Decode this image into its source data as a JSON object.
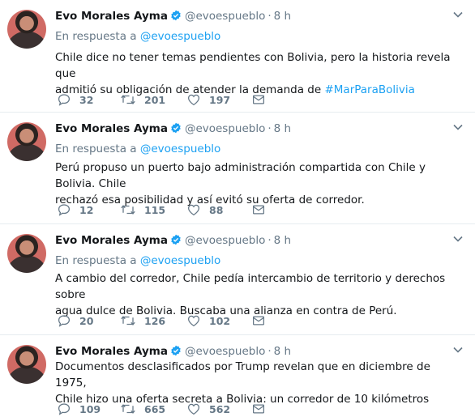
{
  "tweets": [
    {
      "name": "Evo Morales Ayma",
      "handle": "@evoespueblo",
      "dot": "·",
      "time": "8 h",
      "reply_prefix": "En respuesta a",
      "reply_handle": "@evoespueblo",
      "text_line1": "Chile dice no tener temas pendientes con Bolivia, pero la historia revela que",
      "text_line2": "admitió su obligación de atender la demanda de",
      "hashtag": "#MarParaBolivia",
      "replies": "32",
      "retweets": "201",
      "likes": "197"
    },
    {
      "name": "Evo Morales Ayma",
      "handle": "@evoespueblo",
      "dot": "·",
      "time": "8 h",
      "reply_prefix": "En respuesta a",
      "reply_handle": "@evoespueblo",
      "text_line1": "Perú propuso un puerto bajo administración compartida con Chile y Bolivia. Chile",
      "text_line2": "rechazó esa posibilidad y así evitó su oferta de corredor.",
      "replies": "12",
      "retweets": "115",
      "likes": "88"
    },
    {
      "name": "Evo Morales Ayma",
      "handle": "@evoespueblo",
      "dot": "·",
      "time": "8 h",
      "reply_prefix": "En respuesta a",
      "reply_handle": "@evoespueblo",
      "text_line1": "A cambio del corredor, Chile pedía intercambio de territorio y derechos sobre",
      "text_line2": "agua dulce de Bolivia. Buscaba una alianza en contra de Perú.",
      "replies": "20",
      "retweets": "126",
      "likes": "102"
    },
    {
      "name": "Evo Morales Ayma",
      "handle": "@evoespueblo",
      "dot": "·",
      "time": "8 h",
      "text_line1": "Documentos desclasificados por Trump revelan que en diciembre de 1975,",
      "text_line2": "Chile hizo una oferta secreta a Bolivia: un corredor de 10 kilómetros",
      "replies": "109",
      "retweets": "665",
      "likes": "562"
    }
  ],
  "icons": {
    "verified": "verified-badge-icon",
    "menu": "chevron-down-icon",
    "reply": "reply-icon",
    "retweet": "retweet-icon",
    "like": "heart-icon",
    "dm": "envelope-icon"
  },
  "colors": {
    "link": "#1da1f2",
    "secondary": "#657786",
    "divider": "#e6ecf0"
  }
}
